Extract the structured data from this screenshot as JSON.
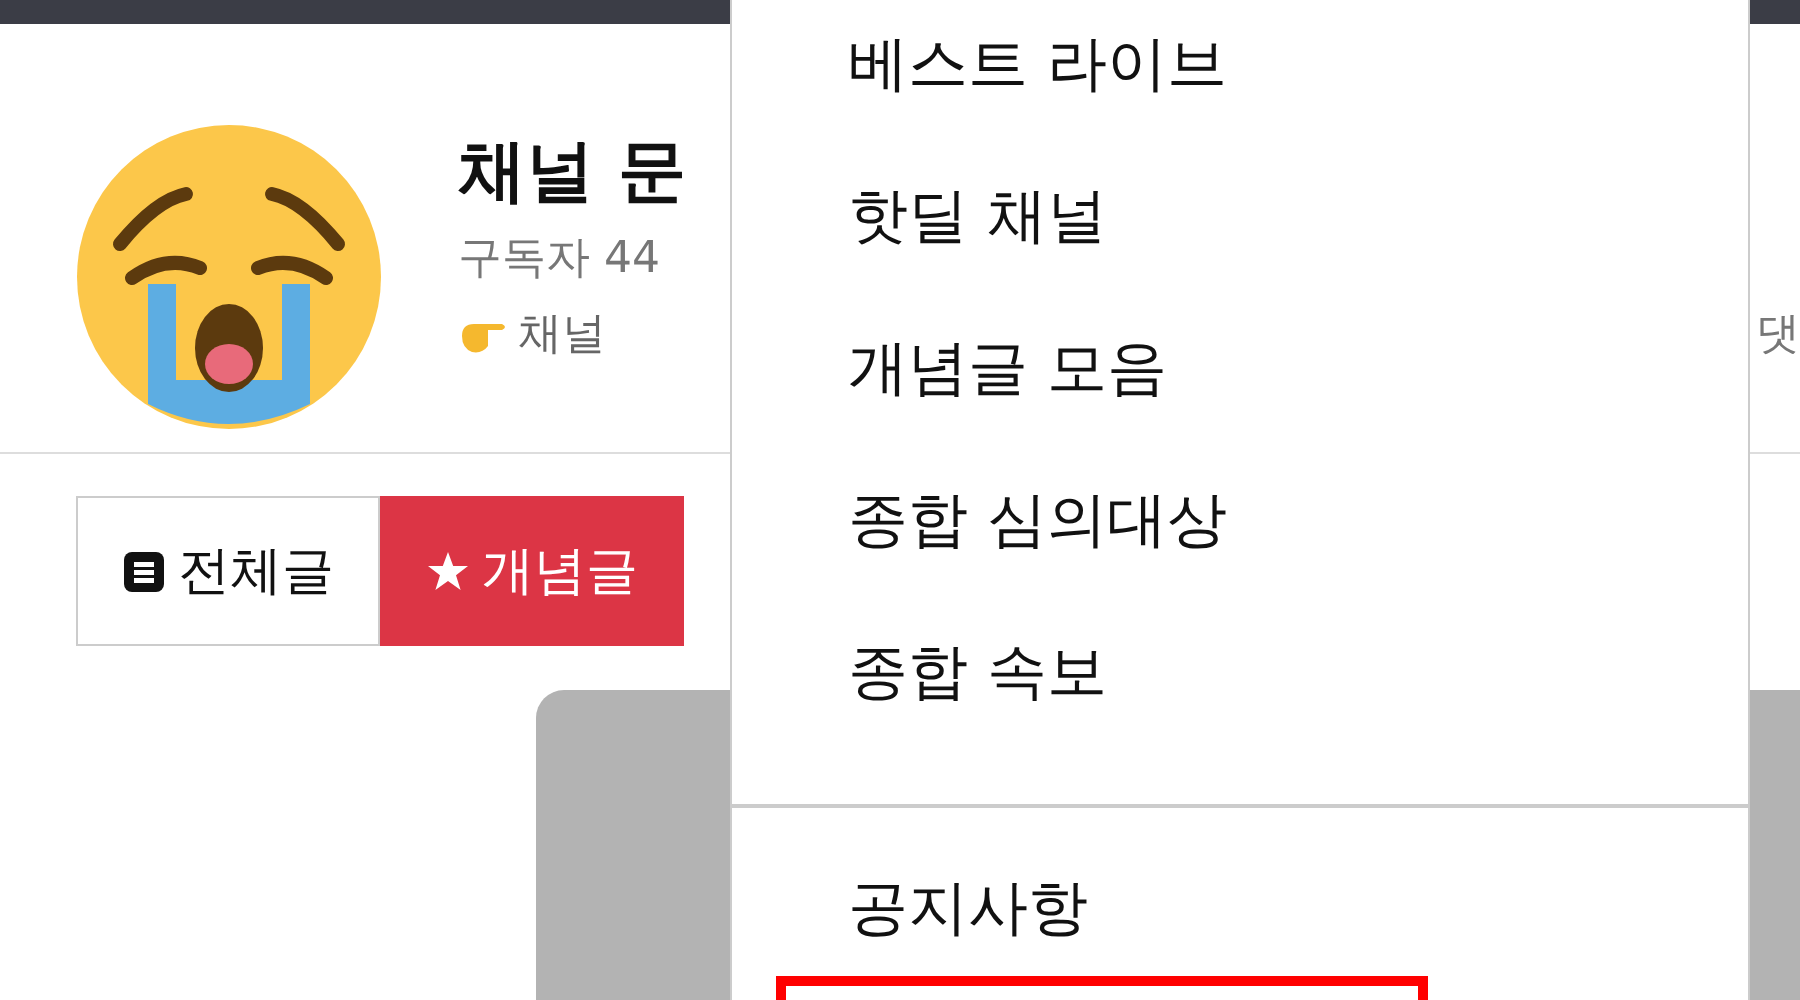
{
  "channel": {
    "title": "채널 문",
    "subscribers": "구독자 44",
    "description": "채널",
    "right_text": "댓"
  },
  "tabs": [
    {
      "label": "전체글",
      "kind": "document",
      "selected": false
    },
    {
      "label": "개념글",
      "kind": "star",
      "selected": true
    }
  ],
  "menu": {
    "sections": [
      [
        "베스트 라이브",
        "핫딜 채널",
        "개념글 모음",
        "종합 심의대상",
        "종합 속보"
      ],
      [
        "공지사항"
      ]
    ],
    "highlight_box": true
  }
}
